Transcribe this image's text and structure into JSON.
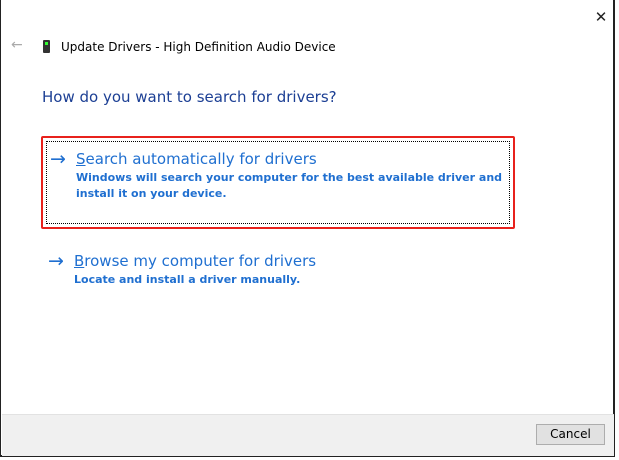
{
  "window": {
    "title": "Update Drivers - High Definition Audio Device",
    "close_label": "✕",
    "back_label": "←"
  },
  "heading": "How do you want to search for drivers?",
  "options": [
    {
      "first_letter": "S",
      "title_rest": "earch automatically for drivers",
      "description": "Windows will search your computer for the best available driver and install it on your device."
    },
    {
      "first_letter": "B",
      "title_rest": "rowse my computer for drivers",
      "description": "Locate and install a driver manually."
    }
  ],
  "arrow": "→",
  "footer": {
    "cancel_label": "Cancel"
  },
  "colors": {
    "link": "#1f6fd0",
    "highlight": "#e8211c",
    "heading": "#1c3f94"
  }
}
